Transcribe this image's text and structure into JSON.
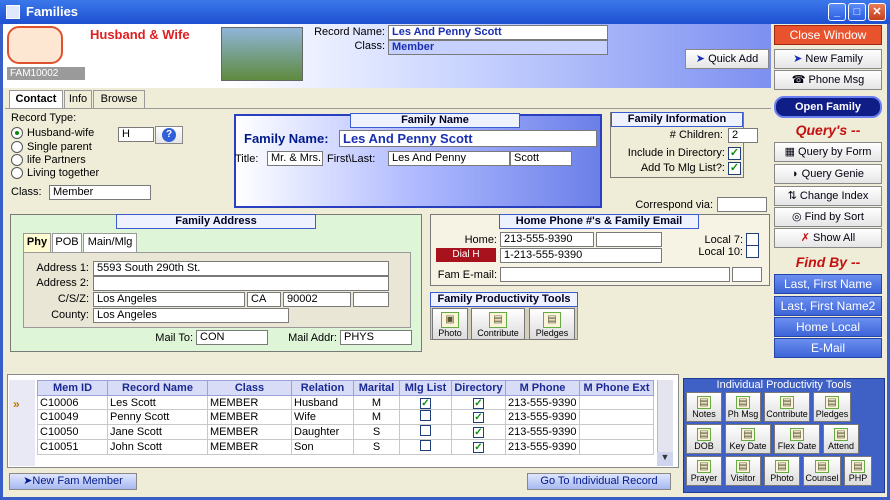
{
  "window": {
    "title": "Families"
  },
  "header": {
    "record_type_heading": "Husband & Wife",
    "family_id": "FAM10002",
    "record_name_label": "Record Name:",
    "record_name_value": "Les And Penny Scott",
    "class_label": "Class:",
    "class_value": "Member"
  },
  "tabs": [
    "Contact",
    "Info",
    "Browse"
  ],
  "record_type": {
    "label": "Record Type:",
    "options": [
      "Husband-wife",
      "Single parent",
      "life Partners",
      "Living together"
    ],
    "selected": "Husband-wife",
    "code": "H",
    "help": "?"
  },
  "class_field": {
    "label": "Class:",
    "value": "Member"
  },
  "family_name": {
    "group_title": "Family Name",
    "name_label": "Family Name:",
    "name_value": "Les And Penny Scott",
    "title_label": "Title:",
    "title_value": "Mr. & Mrs.",
    "first_last_label": "First\\Last:",
    "first_value": "Les And Penny",
    "last_value": "Scott"
  },
  "family_info": {
    "group_title": "Family Information",
    "children_label": "# Children:",
    "children_value": "2",
    "directory_label": "Include in Directory:",
    "mlg_label": "Add To Mlg List?:",
    "correspond_label": "Correspond via:",
    "correspond_value": ""
  },
  "family_address": {
    "group_title": "Family Address",
    "tabs": [
      "Phy",
      "POB",
      "Main/Mlg"
    ],
    "address1_label": "Address 1:",
    "address1_value": "5593 South 290th St.",
    "address2_label": "Address 2:",
    "address2_value": "",
    "csz_label": "C/S/Z:",
    "city": "Los Angeles",
    "state": "CA",
    "zip": "90002",
    "zip_ext": "",
    "county_label": "County:",
    "county_value": "Los Angeles",
    "mail_to_label": "Mail To:",
    "mail_to_value": "CON",
    "mail_addr_label": "Mail Addr:",
    "mail_addr_value": "PHYS"
  },
  "home_phone": {
    "group_title": "Home Phone #'s & Family Email",
    "home_label": "Home:",
    "home_value": "213-555-9390",
    "dial_label": "Dial H",
    "dial_value": "1-213-555-9390",
    "local7_label": "Local 7:",
    "local10_label": "Local 10:",
    "email_label": "Fam E-mail:",
    "email_value": ""
  },
  "family_tools": {
    "title": "Family Productivity Tools",
    "buttons": [
      "Photo",
      "Contribute",
      "Pledges"
    ]
  },
  "right_panel": {
    "close_window": "Close Window",
    "quick_add": "Quick Add",
    "new_family": "New Family",
    "phone_msg": "Phone Msg",
    "open_family": "Open Family",
    "querys_heading": "Query's --",
    "query_buttons": [
      "Query by Form",
      "Query Genie",
      "Change Index",
      "Find by Sort",
      "Show All"
    ],
    "find_by_heading": "Find By --",
    "find_buttons": [
      "Last, First Name",
      "Last, First Name2",
      "Home Local",
      "E-Mail"
    ]
  },
  "members": {
    "columns": [
      "Mem ID",
      "Record Name",
      "Class",
      "Relation",
      "Marital",
      "Mlg List",
      "Directory",
      "M Phone",
      "M Phone Ext"
    ],
    "rows": [
      {
        "id": "C10006",
        "name": "Les Scott",
        "class": "MEMBER",
        "relation": "Husband",
        "marital": "M",
        "mlg": true,
        "dir": true,
        "phone": "213-555-9390",
        "ext": ""
      },
      {
        "id": "C10049",
        "name": "Penny Scott",
        "class": "MEMBER",
        "relation": "Wife",
        "marital": "M",
        "mlg": false,
        "dir": true,
        "phone": "213-555-9390",
        "ext": ""
      },
      {
        "id": "C10050",
        "name": "Jane Scott",
        "class": "MEMBER",
        "relation": "Daughter",
        "marital": "S",
        "mlg": false,
        "dir": true,
        "phone": "213-555-9390",
        "ext": ""
      },
      {
        "id": "C10051",
        "name": "John Scott",
        "class": "MEMBER",
        "relation": "Son",
        "marital": "S",
        "mlg": false,
        "dir": true,
        "phone": "213-555-9390",
        "ext": ""
      }
    ],
    "new_member": "New Fam Member",
    "goto_individual": "Go To Individual Record"
  },
  "individual_tools": {
    "title": "Individual Productivity Tools",
    "row1": [
      "Notes",
      "Ph Msg",
      "Contribute",
      "Pledges"
    ],
    "row2": [
      "DOB",
      "Key Date",
      "Flex Date",
      "Attend"
    ],
    "row3": [
      "Prayer",
      "Visitor",
      "Photo",
      "Counsel",
      "PHP"
    ]
  }
}
